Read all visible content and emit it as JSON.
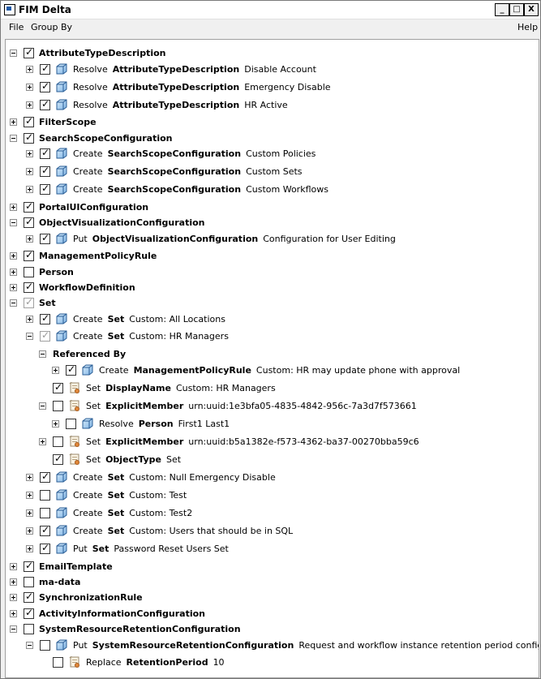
{
  "window": {
    "title": "FIM Delta",
    "minimize": "_",
    "maximize": "□",
    "close": "X"
  },
  "menu": {
    "file": "File",
    "group_by": "Group By",
    "help": "Help"
  },
  "rows": [
    {
      "t": "group",
      "lvl": 0,
      "exp": "minus",
      "chk": true,
      "label": "AttributeTypeDescription"
    },
    {
      "t": "item",
      "lvl": 1,
      "exp": "plus",
      "chk": true,
      "icon": "cube",
      "verb": "Resolve",
      "type": "AttributeTypeDescription",
      "name": "Disable Account"
    },
    {
      "t": "item",
      "lvl": 1,
      "exp": "plus",
      "chk": true,
      "icon": "cube",
      "verb": "Resolve",
      "type": "AttributeTypeDescription",
      "name": "Emergency Disable"
    },
    {
      "t": "item",
      "lvl": 1,
      "exp": "plus",
      "chk": true,
      "icon": "cube",
      "verb": "Resolve",
      "type": "AttributeTypeDescription",
      "name": "HR Active"
    },
    {
      "t": "group",
      "lvl": 0,
      "exp": "plus",
      "chk": true,
      "label": "FilterScope"
    },
    {
      "t": "group",
      "lvl": 0,
      "exp": "minus",
      "chk": true,
      "label": "SearchScopeConfiguration"
    },
    {
      "t": "item",
      "lvl": 1,
      "exp": "plus",
      "chk": true,
      "icon": "cube",
      "verb": "Create",
      "type": "SearchScopeConfiguration",
      "name": "Custom Policies"
    },
    {
      "t": "item",
      "lvl": 1,
      "exp": "plus",
      "chk": true,
      "icon": "cube",
      "verb": "Create",
      "type": "SearchScopeConfiguration",
      "name": "Custom Sets"
    },
    {
      "t": "item",
      "lvl": 1,
      "exp": "plus",
      "chk": true,
      "icon": "cube",
      "verb": "Create",
      "type": "SearchScopeConfiguration",
      "name": "Custom Workflows"
    },
    {
      "t": "group",
      "lvl": 0,
      "exp": "plus",
      "chk": true,
      "label": "PortalUIConfiguration"
    },
    {
      "t": "group",
      "lvl": 0,
      "exp": "minus",
      "chk": true,
      "label": "ObjectVisualizationConfiguration"
    },
    {
      "t": "item",
      "lvl": 1,
      "exp": "plus",
      "chk": true,
      "icon": "cube",
      "verb": "Put",
      "type": "ObjectVisualizationConfiguration",
      "name": "Configuration for User Editing"
    },
    {
      "t": "group",
      "lvl": 0,
      "exp": "plus",
      "chk": true,
      "label": "ManagementPolicyRule"
    },
    {
      "t": "group",
      "lvl": 0,
      "exp": "plus",
      "chk": false,
      "label": "Person"
    },
    {
      "t": "group",
      "lvl": 0,
      "exp": "plus",
      "chk": true,
      "label": "WorkflowDefinition"
    },
    {
      "t": "group",
      "lvl": 0,
      "exp": "minus",
      "chk": true,
      "dim": true,
      "label": "Set"
    },
    {
      "t": "item",
      "lvl": 1,
      "exp": "plus",
      "chk": true,
      "icon": "cube",
      "verb": "Create",
      "type": "Set",
      "name": "Custom: All Locations"
    },
    {
      "t": "item",
      "lvl": 1,
      "exp": "minus",
      "chk": true,
      "dim": true,
      "icon": "cube",
      "verb": "Create",
      "type": "Set",
      "name": "Custom: HR Managers"
    },
    {
      "t": "ref",
      "lvl": 2,
      "exp": "minus",
      "label": "Referenced By"
    },
    {
      "t": "item",
      "lvl": 3,
      "exp": "plus",
      "chk": true,
      "icon": "cube",
      "verb": "Create",
      "type": "ManagementPolicyRule",
      "name": "Custom: HR may update phone with approval"
    },
    {
      "t": "item",
      "lvl": 2,
      "exp": "none",
      "chk": true,
      "icon": "scroll",
      "verb": "Set",
      "type": "DisplayName",
      "name": "Custom: HR Managers"
    },
    {
      "t": "item",
      "lvl": 2,
      "exp": "minus",
      "chk": false,
      "icon": "scroll",
      "verb": "Set",
      "type": "ExplicitMember",
      "name": "urn:uuid:1e3bfa05-4835-4842-956c-7a3d7f573661"
    },
    {
      "t": "item",
      "lvl": 3,
      "exp": "plus",
      "chk": false,
      "icon": "cube",
      "verb": "Resolve",
      "type": "Person",
      "name": "First1 Last1"
    },
    {
      "t": "item",
      "lvl": 2,
      "exp": "plus",
      "chk": false,
      "icon": "scroll",
      "verb": "Set",
      "type": "ExplicitMember",
      "name": "urn:uuid:b5a1382e-f573-4362-ba37-00270bba59c6"
    },
    {
      "t": "item",
      "lvl": 2,
      "exp": "none",
      "chk": true,
      "icon": "scroll",
      "verb": "Set",
      "type": "ObjectType",
      "name": "Set"
    },
    {
      "t": "item",
      "lvl": 1,
      "exp": "plus",
      "chk": true,
      "icon": "cube",
      "verb": "Create",
      "type": "Set",
      "name": "Custom: Null Emergency Disable"
    },
    {
      "t": "item",
      "lvl": 1,
      "exp": "plus",
      "chk": false,
      "icon": "cube",
      "verb": "Create",
      "type": "Set",
      "name": "Custom: Test"
    },
    {
      "t": "item",
      "lvl": 1,
      "exp": "plus",
      "chk": false,
      "icon": "cube",
      "verb": "Create",
      "type": "Set",
      "name": "Custom: Test2"
    },
    {
      "t": "item",
      "lvl": 1,
      "exp": "plus",
      "chk": true,
      "icon": "cube",
      "verb": "Create",
      "type": "Set",
      "name": "Custom: Users that should be in SQL"
    },
    {
      "t": "item",
      "lvl": 1,
      "exp": "plus",
      "chk": true,
      "icon": "cube",
      "verb": "Put",
      "type": "Set",
      "name": "Password Reset Users Set"
    },
    {
      "t": "group",
      "lvl": 0,
      "exp": "plus",
      "chk": true,
      "label": "EmailTemplate"
    },
    {
      "t": "group",
      "lvl": 0,
      "exp": "plus",
      "chk": false,
      "label": "ma-data"
    },
    {
      "t": "group",
      "lvl": 0,
      "exp": "plus",
      "chk": true,
      "label": "SynchronizationRule"
    },
    {
      "t": "group",
      "lvl": 0,
      "exp": "plus",
      "chk": true,
      "label": "ActivityInformationConfiguration"
    },
    {
      "t": "group",
      "lvl": 0,
      "exp": "minus",
      "chk": false,
      "label": "SystemResourceRetentionConfiguration"
    },
    {
      "t": "item",
      "lvl": 1,
      "exp": "minus",
      "chk": false,
      "icon": "cube",
      "verb": "Put",
      "type": "SystemResourceRetentionConfiguration",
      "name": "Request and workflow instance retention period configuration"
    },
    {
      "t": "item",
      "lvl": 2,
      "exp": "none",
      "chk": false,
      "icon": "scroll",
      "verb": "Replace",
      "type": "RetentionPeriod",
      "name": "10"
    }
  ]
}
